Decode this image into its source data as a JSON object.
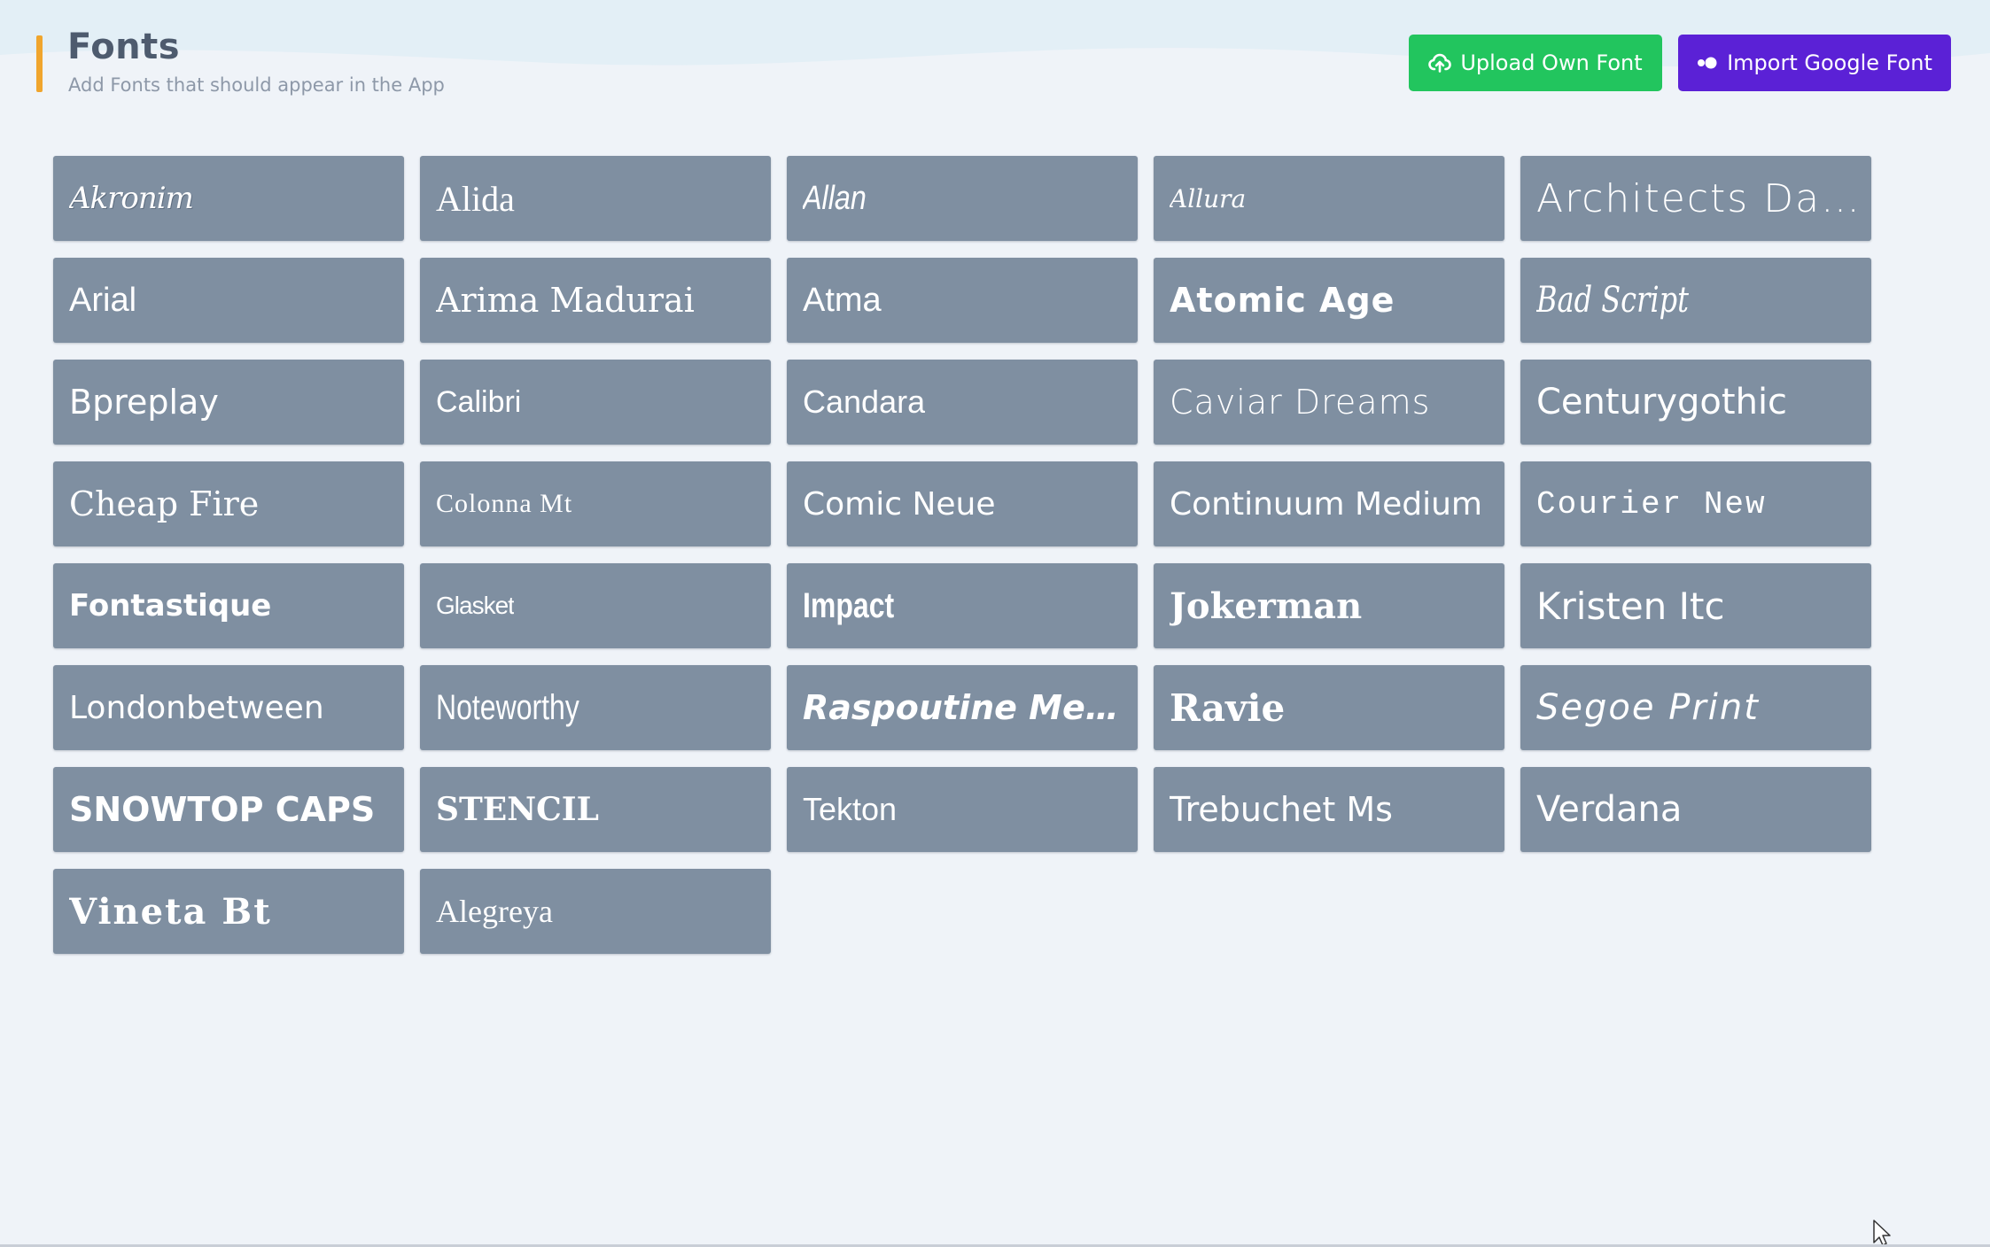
{
  "header": {
    "title": "Fonts",
    "subtitle": "Add Fonts that should appear in the App",
    "upload_button": {
      "label": "Upload Own Font",
      "icon": "cloud-upload-icon",
      "color": "#22c55e"
    },
    "google_button": {
      "label": "Import Google Font",
      "icon": "toggle-dots-icon",
      "color": "#5b21d6"
    },
    "accent_color": "#f0a52d"
  },
  "fonts": [
    "Akronim",
    "Alida",
    "Allan",
    "Allura",
    "Architects Da...",
    "Arial",
    "Arima Madurai",
    "Atma",
    "Atomic Age",
    "Bad Script",
    "Bpreplay",
    "Calibri",
    "Candara",
    "Caviar Dreams",
    "Centurygothic",
    "Cheap Fire",
    "Colonna Mt",
    "Comic Neue",
    "Continuum Medium",
    "Courier New",
    "Fontastique",
    "Glasket",
    "Impact",
    "Jokerman",
    "Kristen Itc",
    "Londonbetween",
    "Noteworthy",
    "Raspoutine Medium",
    "Ravie",
    "Segoe Print",
    "Snowtop Caps",
    "STENCIL",
    "Tekton",
    "Trebuchet Ms",
    "Verdana",
    "Vineta Bt",
    "Alegreya"
  ],
  "tile_color": "#7f8fa1"
}
